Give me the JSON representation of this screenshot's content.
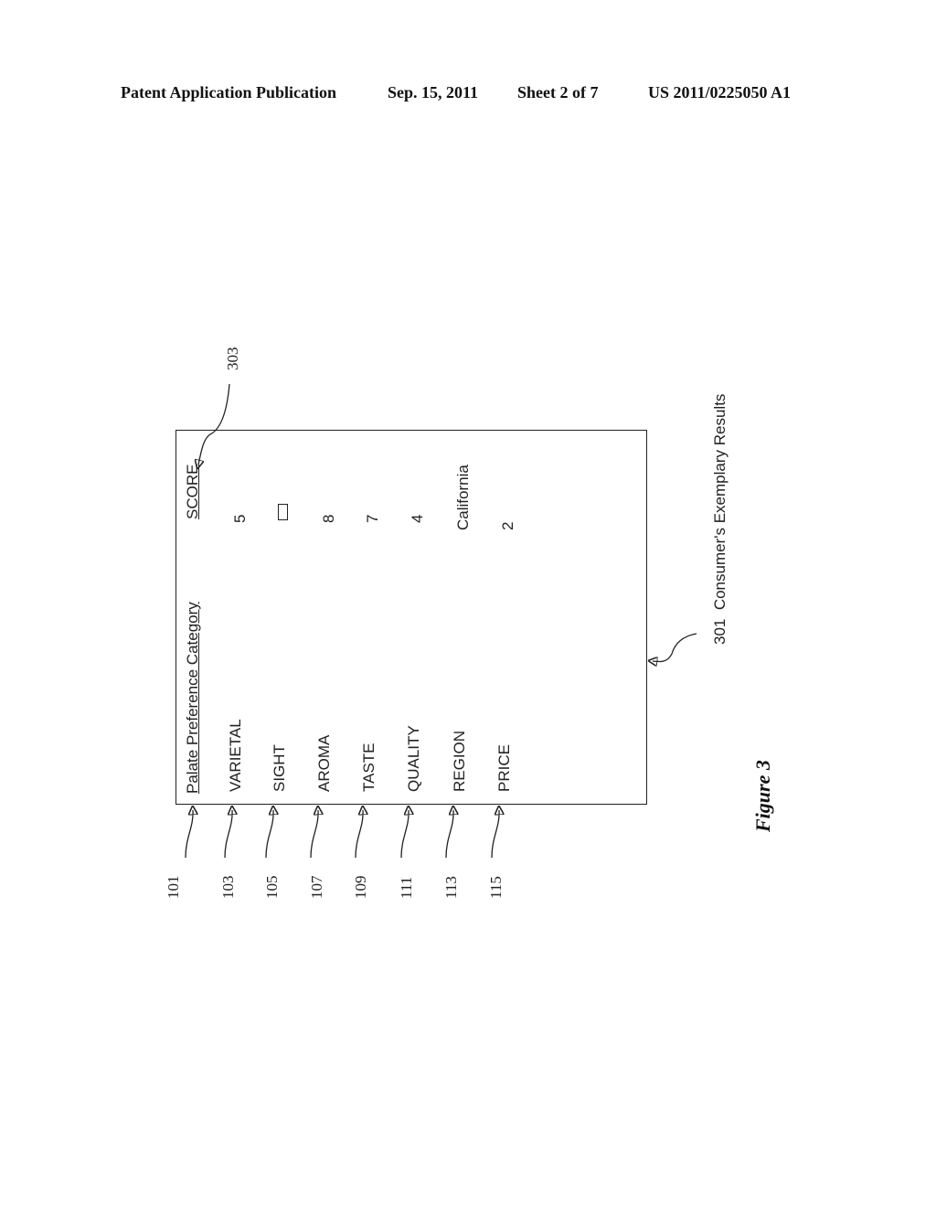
{
  "header": {
    "publication_type": "Patent Application Publication",
    "date": "Sep. 15, 2011",
    "sheet": "Sheet 2 of 7",
    "publication_number": "US 2011/0225050 A1"
  },
  "figure": {
    "caption": "Figure 3",
    "box_ref": "301",
    "box_title": "Consumer's Exemplary Results",
    "score_ref": "303",
    "column_headers": {
      "category": "Palate Preference Category",
      "score": "SCORE"
    },
    "rows": [
      {
        "ref": "103",
        "category": "VARIETAL",
        "score": "5"
      },
      {
        "ref": "105",
        "category": "SIGHT",
        "score": "",
        "score_is_empty_box": true
      },
      {
        "ref": "107",
        "category": "AROMA",
        "score": "8"
      },
      {
        "ref": "109",
        "category": "TASTE",
        "score": "7"
      },
      {
        "ref": "111",
        "category": "QUALITY",
        "score": "4"
      },
      {
        "ref": "113",
        "category": "REGION",
        "score": "California"
      },
      {
        "ref": "115",
        "category": "PRICE",
        "score": "2"
      }
    ],
    "header_ref": "101"
  }
}
